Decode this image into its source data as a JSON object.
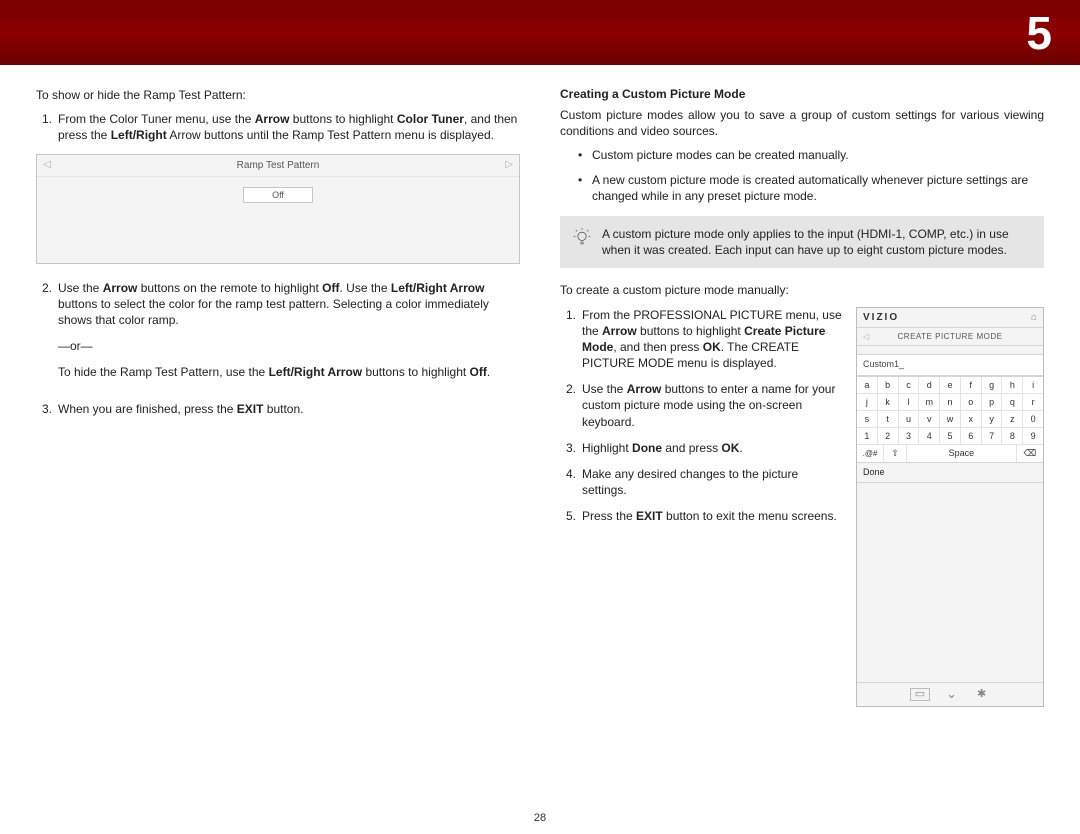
{
  "chapter": "5",
  "page_number": "28",
  "left": {
    "intro": "To show or hide the Ramp Test Pattern:",
    "step1_pre": "From the Color Tuner menu, use the ",
    "step1_b1": "Arrow",
    "step1_mid": " buttons to highlight ",
    "step1_b2": "Color Tuner",
    "step1_mid2": ", and then press the ",
    "step1_b3": "Left/Right",
    "step1_end": " Arrow buttons until the Ramp Test Pattern menu is displayed.",
    "ramp_title": "Ramp Test Pattern",
    "ramp_value": "Off",
    "step2_pre": "Use the ",
    "step2_b1": "Arrow",
    "step2_mid": " buttons on the remote to highlight ",
    "step2_b2": "Off",
    "step2_mid2": ". Use the ",
    "step2_b3": "Left/Right Arrow",
    "step2_end": " buttons to select the color for the ramp test pattern. Selecting a color immediately shows that color ramp.",
    "or": "—or—",
    "step2_alt_pre": "To hide the Ramp Test Pattern, use the ",
    "step2_alt_b": "Left/Right Arrow",
    "step2_alt_end": " buttons to highlight ",
    "step2_alt_b2": "Off",
    "step2_alt_end2": ".",
    "step3_pre": "When you are finished, press the ",
    "step3_b": "EXIT",
    "step3_end": " button."
  },
  "right": {
    "heading": "Creating a Custom Picture Mode",
    "intro": "Custom picture modes allow you to save a group of custom settings for various viewing conditions and video sources.",
    "bullet1": "Custom picture modes can be created manually.",
    "bullet2": "A new custom picture mode is created automatically whenever picture settings are changed while in any preset picture mode.",
    "tip": "A custom picture mode only applies to the input (HDMI-1, COMP, etc.) in use when it was created. Each input can have up to eight custom picture modes.",
    "intro2": "To create a custom picture mode manually:",
    "s1_pre": "From the PROFESSIONAL PICTURE menu, use the ",
    "s1_b1": "Arrow",
    "s1_mid": " buttons to highlight ",
    "s1_b2": "Create Picture Mode",
    "s1_mid2": ", and then press ",
    "s1_b3": "OK",
    "s1_end": ". The CREATE PICTURE MODE menu is displayed.",
    "s2_pre": "Use the ",
    "s2_b": "Arrow",
    "s2_end": " buttons to enter a name for your custom picture mode using the on-screen keyboard.",
    "s3_pre": "Highlight ",
    "s3_b1": "Done",
    "s3_mid": " and press ",
    "s3_b2": "OK",
    "s3_end": ".",
    "s4": "Make any desired changes to the picture settings.",
    "s5_pre": "Press the ",
    "s5_b": "EXIT",
    "s5_end": " button to exit the menu screens."
  },
  "vizio": {
    "logo": "VIZIO",
    "sub": "CREATE PICTURE MODE",
    "name": "Custom1",
    "done": "Done",
    "space": "Space",
    "symbols": ".@#",
    "rows": [
      [
        "a",
        "b",
        "c",
        "d",
        "e",
        "f",
        "g",
        "h",
        "i"
      ],
      [
        "j",
        "k",
        "l",
        "m",
        "n",
        "o",
        "p",
        "q",
        "r"
      ],
      [
        "s",
        "t",
        "u",
        "v",
        "w",
        "x",
        "y",
        "z",
        "0"
      ],
      [
        "1",
        "2",
        "3",
        "4",
        "5",
        "6",
        "7",
        "8",
        "9"
      ]
    ]
  }
}
